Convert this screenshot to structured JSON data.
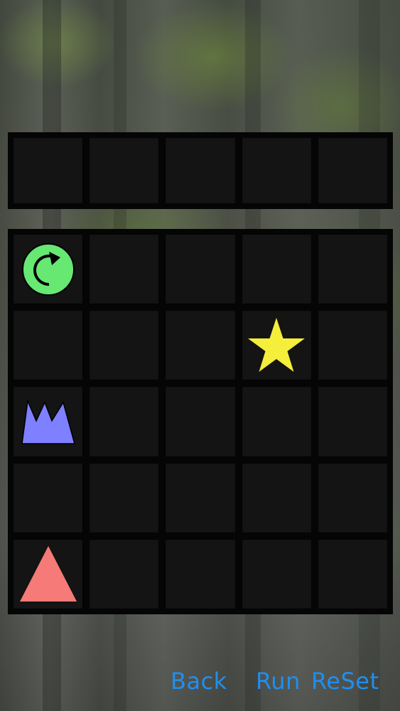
{
  "buttons": {
    "back": "Back",
    "run": "Run",
    "reset": "ReSet"
  },
  "colors": {
    "button_text": "#1f8ff0",
    "grid_line": "#050505",
    "rotate_piece": "#66e873",
    "star_piece": "#f5ee3a",
    "crown_piece": "#7f80ff",
    "triangle_piece": "#f57a78"
  },
  "board": {
    "rows": 5,
    "columns": 5,
    "pieces": [
      {
        "name": "rotate-icon",
        "row": 1,
        "col": 1
      },
      {
        "name": "star-icon",
        "row": 2,
        "col": 4
      },
      {
        "name": "crown-icon",
        "row": 3,
        "col": 1
      },
      {
        "name": "triangle-icon",
        "row": 5,
        "col": 1
      }
    ]
  },
  "command_bar": {
    "slots": 5
  }
}
